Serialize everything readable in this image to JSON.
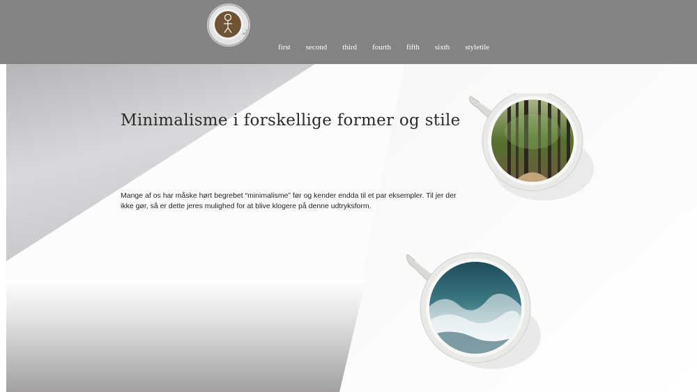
{
  "header": {
    "logo_icon": "coffee-cup-logo-icon",
    "nav": [
      {
        "label": "first"
      },
      {
        "label": "second"
      },
      {
        "label": "third"
      },
      {
        "label": "fourth"
      },
      {
        "label": "fifth"
      },
      {
        "label": "sixth"
      },
      {
        "label": "styletile"
      }
    ]
  },
  "hero": {
    "title": "Minimalisme i forskellige former og stile",
    "body": "Mange af os har måske hørt begrebet “minimalisme” før og kender endda til et par eksempler. Til jer der ikke gør, så er dette jeres mulighed for at blive klogere på denne udtryksform.",
    "images": [
      {
        "icon": "forest-cup-image"
      },
      {
        "icon": "ocean-cup-image"
      }
    ]
  },
  "colors": {
    "header_bg": "#838383",
    "logo_brown": "#6e5434",
    "text_dark": "#1e1e1e"
  }
}
